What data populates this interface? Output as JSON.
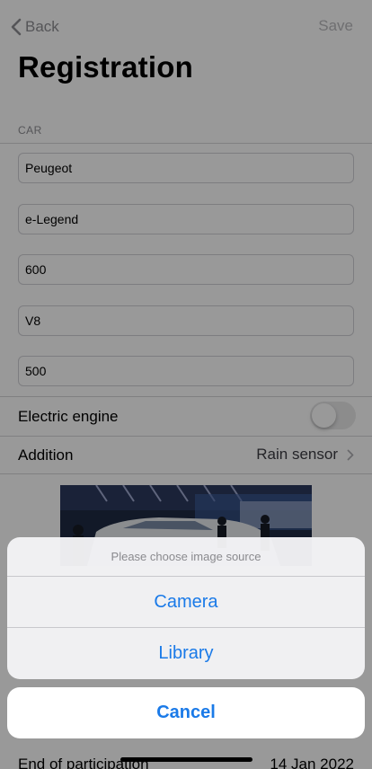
{
  "nav": {
    "back_label": "Back",
    "save_label": "Save"
  },
  "title": "Registration",
  "section": {
    "header": "CAR"
  },
  "fields": [
    {
      "value": "Peugeot"
    },
    {
      "value": "e-Legend"
    },
    {
      "value": "600"
    },
    {
      "value": "V8"
    },
    {
      "value": "500"
    }
  ],
  "electric_engine": {
    "label": "Electric engine",
    "enabled": false
  },
  "addition": {
    "label": "Addition",
    "value": "Rain sensor"
  },
  "end_of_participation": {
    "label": "End of participation",
    "value": "14 Jan 2022"
  },
  "action_sheet": {
    "message": "Please choose image source",
    "camera_label": "Camera",
    "library_label": "Library",
    "cancel_label": "Cancel"
  },
  "colors": {
    "accent": "#1a7ae8",
    "secondary_text": "#8e8e93"
  }
}
